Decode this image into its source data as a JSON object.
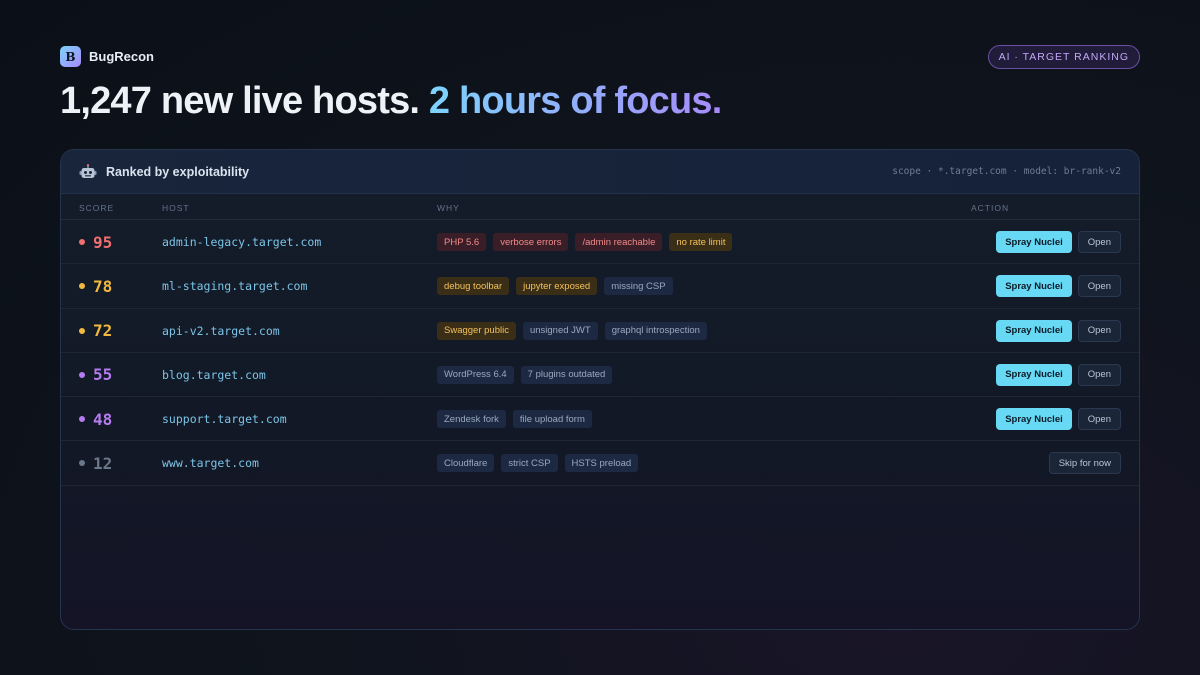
{
  "brand": {
    "logo_letter": "B",
    "name": "BugRecon"
  },
  "badge": {
    "label": "AI · TARGET RANKING"
  },
  "headline": {
    "part1": "1,247 new live hosts.",
    "part2": "2 hours of focus."
  },
  "panel": {
    "icon": "robot-icon",
    "title": "Ranked by exploitability",
    "meta": "scope · *.target.com · model: br-rank-v2",
    "columns": {
      "score": "SCORE",
      "host": "HOST",
      "why": "WHY",
      "action": "ACTION"
    }
  },
  "colors": {
    "accent": "#67d9f5",
    "score_high": "#f06f6f",
    "score_medium": "#f3b93f",
    "score_low": "#b47cf0",
    "score_none": "#6b7889"
  },
  "rows": [
    {
      "score": "95",
      "severity": "high",
      "host": "admin-legacy.target.com",
      "tags": [
        {
          "text": "PHP 5.6",
          "tone": "red"
        },
        {
          "text": "verbose errors",
          "tone": "red"
        },
        {
          "text": "/admin reachable",
          "tone": "red"
        },
        {
          "text": "no rate limit",
          "tone": "amber"
        }
      ],
      "actions": [
        {
          "label": "Spray Nuclei",
          "kind": "primary"
        },
        {
          "label": "Open",
          "kind": "secondary"
        }
      ]
    },
    {
      "score": "78",
      "severity": "medium",
      "host": "ml-staging.target.com",
      "tags": [
        {
          "text": "debug toolbar",
          "tone": "amber"
        },
        {
          "text": "jupyter exposed",
          "tone": "amber"
        },
        {
          "text": "missing CSP",
          "tone": "gray"
        }
      ],
      "actions": [
        {
          "label": "Spray Nuclei",
          "kind": "primary"
        },
        {
          "label": "Open",
          "kind": "secondary"
        }
      ]
    },
    {
      "score": "72",
      "severity": "medium",
      "host": "api-v2.target.com",
      "tags": [
        {
          "text": "Swagger public",
          "tone": "amber"
        },
        {
          "text": "unsigned JWT",
          "tone": "gray"
        },
        {
          "text": "graphql introspection",
          "tone": "gray"
        }
      ],
      "actions": [
        {
          "label": "Spray Nuclei",
          "kind": "primary"
        },
        {
          "label": "Open",
          "kind": "secondary"
        }
      ]
    },
    {
      "score": "55",
      "severity": "low",
      "host": "blog.target.com",
      "tags": [
        {
          "text": "WordPress 6.4",
          "tone": "gray"
        },
        {
          "text": "7 plugins outdated",
          "tone": "gray"
        }
      ],
      "actions": [
        {
          "label": "Spray Nuclei",
          "kind": "primary"
        },
        {
          "label": "Open",
          "kind": "secondary"
        }
      ]
    },
    {
      "score": "48",
      "severity": "low",
      "host": "support.target.com",
      "tags": [
        {
          "text": "Zendesk fork",
          "tone": "gray"
        },
        {
          "text": "file upload form",
          "tone": "gray"
        }
      ],
      "actions": [
        {
          "label": "Spray Nuclei",
          "kind": "primary"
        },
        {
          "label": "Open",
          "kind": "secondary"
        }
      ]
    },
    {
      "score": "12",
      "severity": "none",
      "host": "www.target.com",
      "tags": [
        {
          "text": "Cloudflare",
          "tone": "gray"
        },
        {
          "text": "strict CSP",
          "tone": "gray"
        },
        {
          "text": "HSTS preload",
          "tone": "gray"
        }
      ],
      "actions": [
        {
          "label": "Skip for now",
          "kind": "secondary"
        }
      ]
    }
  ]
}
